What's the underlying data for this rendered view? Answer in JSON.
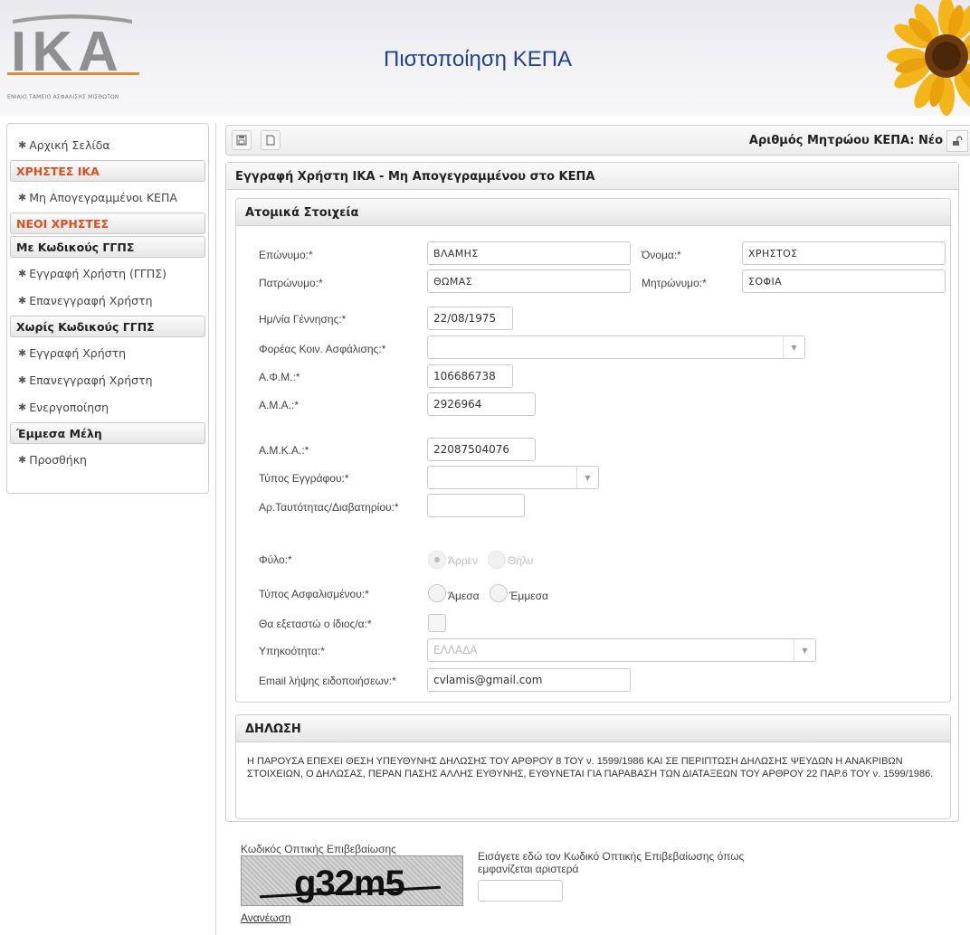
{
  "header": {
    "logo_text": "IKA",
    "logo_subtitle": "ΕΝΙΑΙΟ ΤΑΜΕΙΟ ΑΣΦΑΛΙΣΗΣ ΜΙΣΘΩΤΩΝ",
    "title": "Πιστοποίηση ΚΕΠΑ"
  },
  "sidebar": {
    "home": "Αρχική Σελίδα",
    "groups": [
      {
        "title": "ΧΡΗΣΤΕΣ ΙΚΑ",
        "color": "#d9501e",
        "items": [
          "Μη Απογεγραμμένοι ΚΕΠΑ"
        ]
      },
      {
        "title": "ΝΕΟΙ ΧΡΗΣΤΕΣ",
        "color": "#d9501e",
        "items": []
      },
      {
        "title": "Με Κωδικούς ΓΓΠΣ",
        "color": "#222222",
        "items": [
          "Εγγραφή Χρήστη (ΓΓΠΣ)",
          "Επανεγγραφή Χρήστη"
        ]
      },
      {
        "title": "Χωρίς Κωδικούς ΓΓΠΣ",
        "color": "#222222",
        "items": [
          "Εγγραφή Χρήστη",
          "Επανεγγραφή Χρήστη",
          "Ενεργοποίηση"
        ]
      },
      {
        "title": "Έμμεσα Μέλη",
        "color": "#222222",
        "items": [
          "Προσθήκη"
        ]
      }
    ]
  },
  "toolbar": {
    "registry_label": "Αριθμός Μητρώου ΚΕΠΑ: Νέο"
  },
  "form": {
    "title": "Εγγραφή Χρήστη ΙΚΑ - Μη Απογεγραμμένου στο ΚΕΠΑ",
    "personal_title": "Ατομικά Στοιχεία",
    "surname_label": "Επώνυμο:*",
    "surname": "ΒΛΑΜΗΣ",
    "name_label": "Όνομα:*",
    "name": "ΧΡΗΣΤΟΣ",
    "father_label": "Πατρώνυμο:*",
    "father": "ΘΩΜΑΣ",
    "mother_label": "Μητρώνυμο:*",
    "mother": "ΣΟΦΙΑ",
    "birth_label": "Ημ/νία Γέννησης:*",
    "birth": "22/08/1975",
    "insurer_label": "Φορέας Κοιν. Ασφάλισης:*",
    "insurer": "",
    "afm_label": "Α.Φ.Μ.:*",
    "afm": "106686738",
    "ama_label": "Α.Μ.Α.:*",
    "ama": "2926964",
    "amka_label": "Α.Μ.Κ.Α.:*",
    "amka": "22087504076",
    "doctype_label": "Τύπος Εγγράφου:*",
    "doctype": "",
    "idnum_label": "Αρ.Ταυτότητας/Διαβατηρίου:*",
    "idnum": "",
    "gender_label": "Φύλο:*",
    "gender_options": [
      "Άρρεν",
      "Θήλυ"
    ],
    "insured_type_label": "Τύπος Ασφαλισμένου:*",
    "insured_type_options": [
      "Άμεσα",
      "Έμμεσα"
    ],
    "self_exam_label": "Θα εξεταστώ ο ίδιος/α:*",
    "citizenship_label": "Υπηκοότητα:*",
    "citizenship": "ΕΛΛΑΔΑ",
    "email_label": "Email λήψης ειδοποιήσεων:*",
    "email": "cvlamis@gmail.com"
  },
  "declaration": {
    "title": "ΔΗΛΩΣΗ",
    "text": "Η ΠΑΡΟΥΣΑ ΕΠΕΧΕΙ ΘΕΣΗ ΥΠΕΥΘΥΝΗΣ ΔΗΛΩΣΗΣ ΤΟΥ ΑΡΘΡΟΥ 8 ΤΟΥ ν. 1599/1986 ΚΑΙ ΣΕ ΠΕΡΙΠΤΩΣΗ ΔΗΛΩΣΗΣ ΨΕΥΔΩΝ Η ΑΝΑΚΡΙΒΩΝ ΣΤΟΙΧΕΙΩΝ, Ο ΔΗΛΩΣΑΣ, ΠΕΡΑΝ ΠΑΣΗΣ ΑΛΛΗΣ ΕΥΘΥΝΗΣ, ΕΥΘΥΝΕΤΑΙ ΓΙΑ ΠΑΡΑΒΑΣΗ ΤΩΝ ΔΙΑΤΑΞΕΩΝ ΤΟΥ ΑΡΘΡΟΥ 22 ΠΑΡ.6 ΤΟΥ ν. 1599/1986."
  },
  "captcha": {
    "title": "Κωδικός Οπτικής Επιβεβαίωσης",
    "code": "g32m5",
    "refresh": "Ανανέωση",
    "hint": "Εισάγετε εδώ τον Κωδικό Οπτικής Επιβεβαίωσης όπως εμφανίζεται αριστερά",
    "value": ""
  }
}
